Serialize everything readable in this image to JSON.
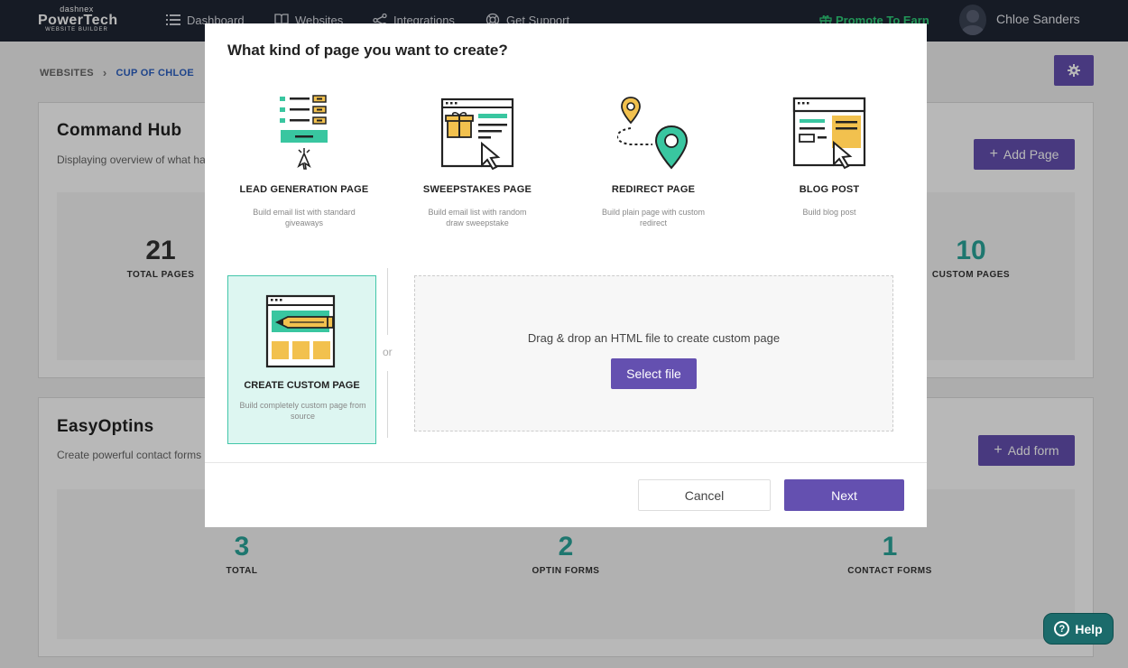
{
  "app": {
    "logo_top": "dashnex",
    "logo_main": "PowerTech",
    "logo_sub": "WEBSITE BUILDER"
  },
  "nav": {
    "items": [
      {
        "label": "Dashboard",
        "icon": "list-icon"
      },
      {
        "label": "Websites",
        "icon": "book-icon"
      },
      {
        "label": "Integrations",
        "icon": "share-icon"
      },
      {
        "label": "Get Support",
        "icon": "lifebuoy-icon"
      }
    ],
    "promote": "Promote To Earn",
    "user": "Chloe Sanders"
  },
  "breadcrumb": {
    "root": "WEBSITES",
    "current": "CUP OF CHLOE"
  },
  "command_hub": {
    "title": "Command Hub",
    "subtitle": "Displaying overview of what ha",
    "add_button": "Add Page",
    "stats": [
      {
        "value": "21",
        "label": "TOTAL PAGES"
      },
      {
        "value": "10",
        "label": "CUSTOM PAGES"
      }
    ]
  },
  "easyoptins": {
    "title": "EasyOptins",
    "subtitle": "Create powerful contact forms",
    "add_button": "Add form",
    "stats": [
      {
        "value": "3",
        "label": "TOTAL"
      },
      {
        "value": "2",
        "label": "OPTIN FORMS"
      },
      {
        "value": "1",
        "label": "CONTACT FORMS"
      }
    ]
  },
  "help": {
    "label": "Help"
  },
  "modal": {
    "title": "What kind of page you want to create?",
    "page_types": [
      {
        "name": "LEAD GENERATION PAGE",
        "desc": "Build email list with standard giveaways"
      },
      {
        "name": "SWEEPSTAKES PAGE",
        "desc": "Build email list with random draw sweepstake"
      },
      {
        "name": "REDIRECT PAGE",
        "desc": "Build plain page with custom redirect"
      },
      {
        "name": "BLOG POST",
        "desc": "Build blog post"
      }
    ],
    "custom": {
      "name": "CREATE CUSTOM PAGE",
      "desc": "Build completely custom page from source"
    },
    "or_label": "or",
    "dropzone_text": "Drag & drop an HTML file to create custom page",
    "select_file": "Select file",
    "cancel": "Cancel",
    "next": "Next"
  },
  "colors": {
    "nav_bg": "#1f2634",
    "accent": "#6450b0",
    "teal": "#2aa59a",
    "promote": "#2fd07a",
    "selected_bg": "#ddf6f1"
  }
}
